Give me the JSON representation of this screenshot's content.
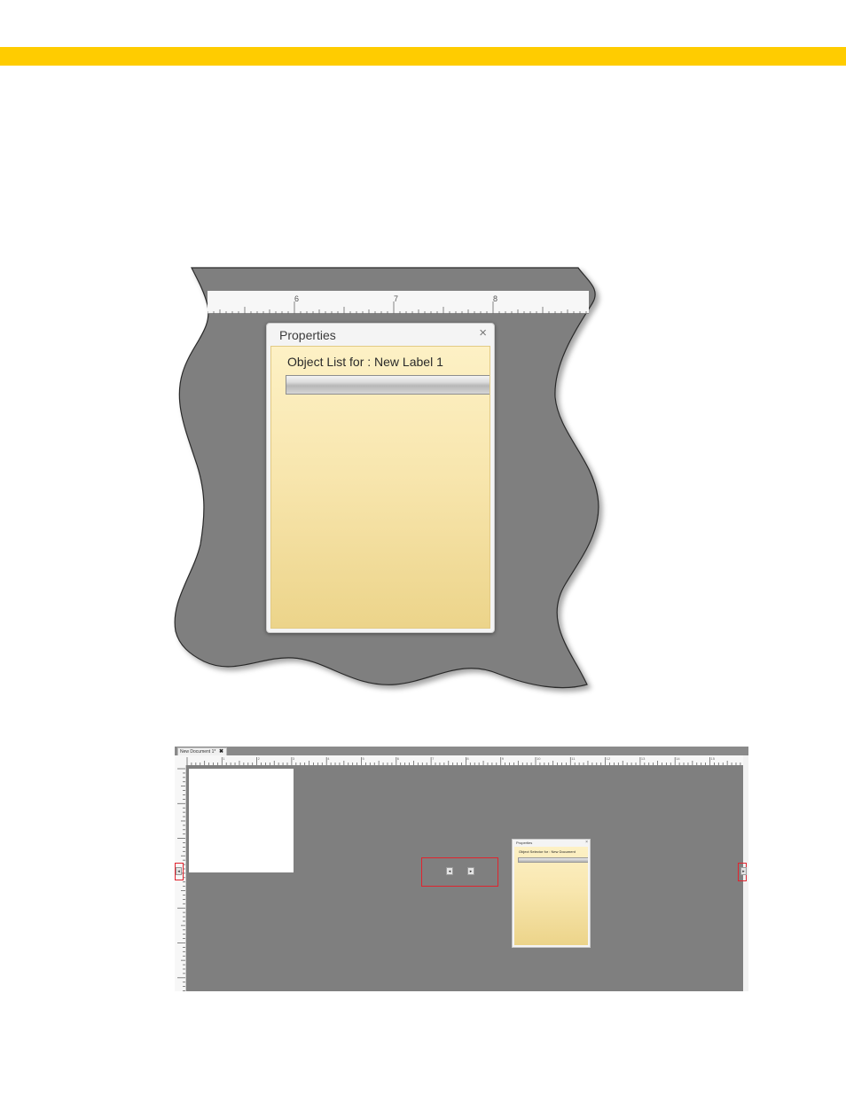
{
  "colors": {
    "banner": "#ffcc00",
    "workspace": "#7f7f7f",
    "callout": "#e0242e",
    "panel_top": "#fdf1c5",
    "panel_bottom": "#ecd48a"
  },
  "zoom_figure": {
    "ruler_labels": [
      "6",
      "7",
      "8"
    ],
    "properties_panel": {
      "title": "Properties",
      "close_glyph": "×",
      "object_list_label": "Object List for :   New Label 1"
    }
  },
  "app_figure": {
    "document_tab": {
      "label": "New Document 1*",
      "close_glyph": "✖"
    },
    "ruler_labels": [
      "1",
      "2",
      "3",
      "4",
      "5",
      "6",
      "7",
      "8",
      "9",
      "10",
      "11",
      "12",
      "13",
      "14",
      "15"
    ],
    "nav_left_glyph": "◂",
    "nav_right_glyph": "▸",
    "properties_panel": {
      "title": "Properties",
      "close_glyph": "×",
      "object_list_label": "Object Selector for :   New Document"
    }
  }
}
